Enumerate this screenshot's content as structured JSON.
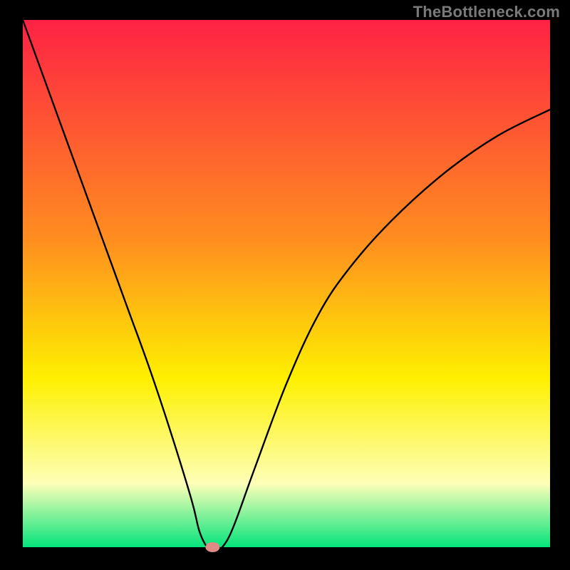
{
  "watermark": "TheBottleneck.com",
  "chart_data": {
    "type": "line",
    "title": "",
    "xlabel": "",
    "ylabel": "",
    "xlim": [
      0,
      100
    ],
    "ylim": [
      0,
      100
    ],
    "x": [
      0,
      4,
      8,
      12,
      16,
      20,
      24,
      28,
      32,
      33.5,
      35,
      36,
      37,
      38,
      40,
      44,
      50,
      56,
      62,
      70,
      80,
      90,
      100
    ],
    "y": [
      100,
      89,
      78,
      67,
      56,
      45,
      34,
      22,
      9,
      3,
      0,
      0,
      0,
      0.2,
      4,
      15,
      31,
      44,
      53,
      62,
      71,
      78,
      83
    ],
    "marker": {
      "x": 36,
      "y": 0
    },
    "colors": {
      "gradient_top": "#fe2244",
      "gradient_mid1": "#ff8f1f",
      "gradient_mid2": "#fef000",
      "gradient_low": "#fdffb8",
      "gradient_bottom": "#04e47c",
      "frame": "#000000",
      "curve": "#000000",
      "marker": "#e08a85"
    }
  }
}
